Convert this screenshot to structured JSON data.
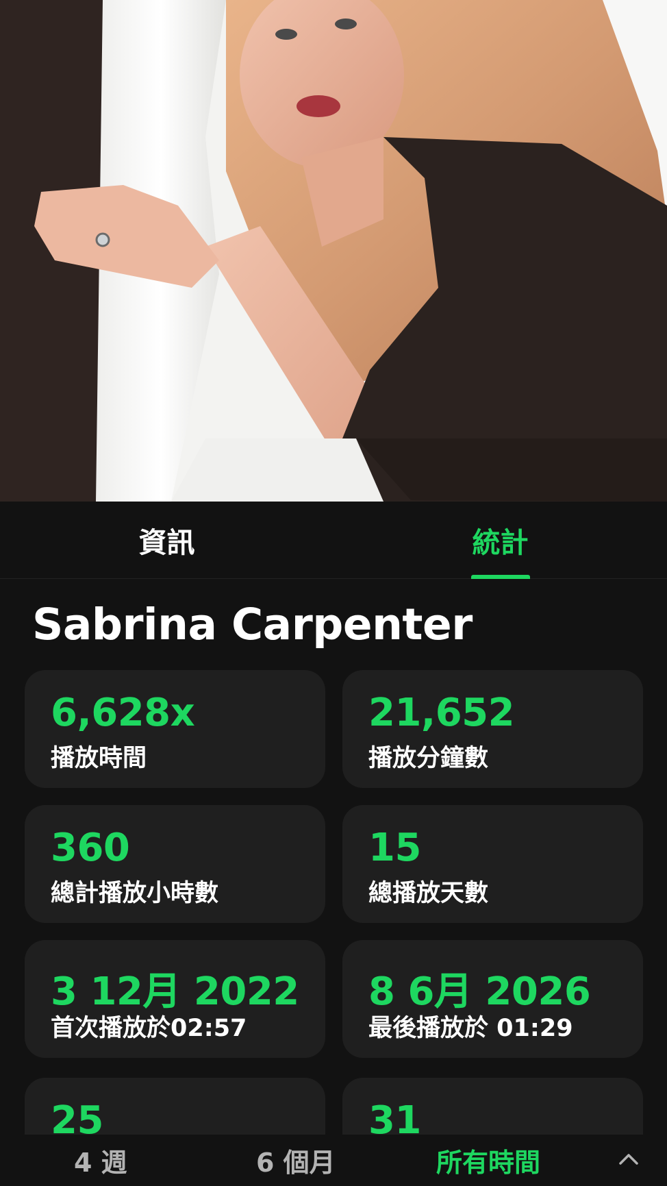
{
  "hero": {
    "image_label": "artist-photo"
  },
  "tabs": [
    {
      "label": "資訊",
      "active": false
    },
    {
      "label": "統計",
      "active": true
    }
  ],
  "artist": {
    "name": "Sabrina Carpenter"
  },
  "stats": [
    {
      "value": "6,628x",
      "label": "播放時間"
    },
    {
      "value": "21,652",
      "label": "播放分鐘數"
    },
    {
      "value": "360",
      "label": "總計播放小時數"
    },
    {
      "value": "15",
      "label": "總播放天數"
    },
    {
      "value": "3 12月 2022",
      "label": "首次播放於02:57"
    },
    {
      "value": "8 6月 2026",
      "label": "最後播放於 01:29"
    },
    {
      "value": "25",
      "label": ""
    },
    {
      "value": "31",
      "label": ""
    }
  ],
  "periods": [
    {
      "label": "4 週",
      "active": false
    },
    {
      "label": "6 個月",
      "active": false
    },
    {
      "label": "所有時間",
      "active": true
    }
  ],
  "icons": {
    "collapse": "chevron-up-icon"
  },
  "colors": {
    "accent": "#1ed760",
    "background": "#121212",
    "card": "#1f1f1f",
    "text_primary": "#ffffff",
    "text_secondary": "#b3b3b3"
  }
}
